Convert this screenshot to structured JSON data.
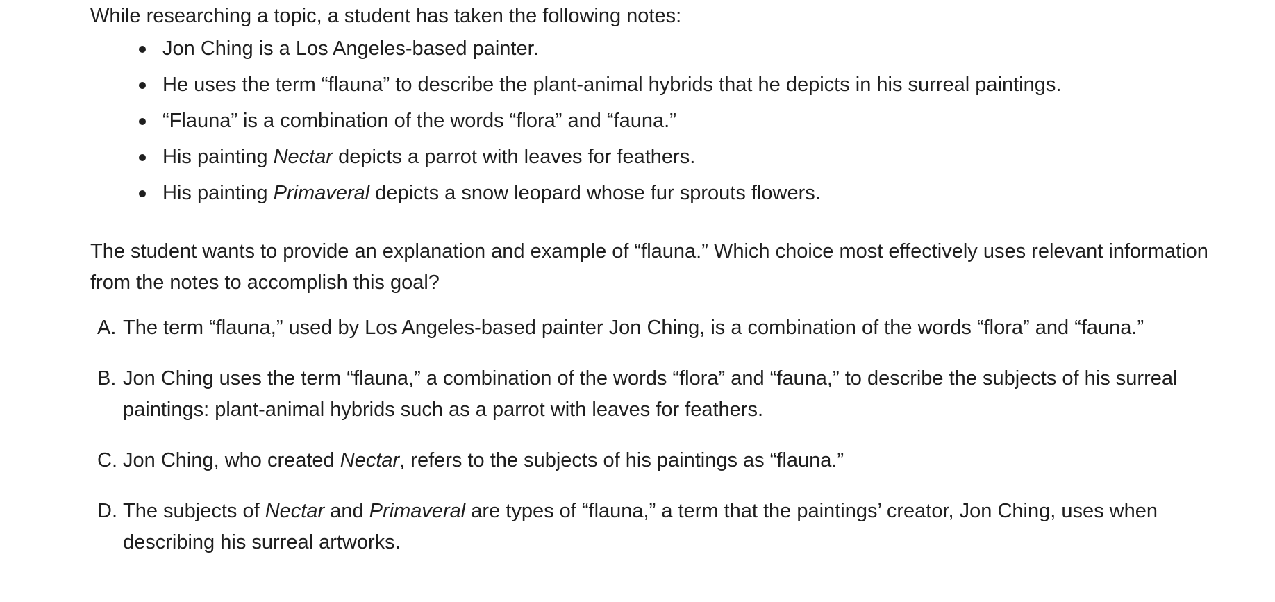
{
  "intro": "While researching a topic, a student has taken the following notes:",
  "notes": [
    {
      "parts": [
        {
          "text": "Jon Ching is a Los Angeles-based painter.",
          "italic": false
        }
      ]
    },
    {
      "parts": [
        {
          "text": "He uses the term “flauna” to describe the plant-animal hybrids that he depicts in his surreal paintings.",
          "italic": false
        }
      ]
    },
    {
      "parts": [
        {
          "text": "“Flauna” is a combination of the words “flora” and “fauna.”",
          "italic": false
        }
      ]
    },
    {
      "parts": [
        {
          "text": "His painting ",
          "italic": false
        },
        {
          "text": "Nectar",
          "italic": true
        },
        {
          "text": " depicts a parrot with leaves for feathers.",
          "italic": false
        }
      ]
    },
    {
      "parts": [
        {
          "text": "His painting ",
          "italic": false
        },
        {
          "text": "Primaveral",
          "italic": true
        },
        {
          "text": " depicts a snow leopard whose fur sprouts flowers.",
          "italic": false
        }
      ]
    }
  ],
  "question": "The student wants to provide an explanation and example of “flauna.” Which choice most effectively uses relevant information from the notes to accomplish this goal?",
  "options": [
    {
      "letter": "A.",
      "parts": [
        {
          "text": "The term “flauna,” used by Los Angeles-based painter Jon Ching, is a combination of the words “flora” and “fauna.”",
          "italic": false
        }
      ]
    },
    {
      "letter": "B.",
      "parts": [
        {
          "text": "Jon Ching uses the term “flauna,” a combination of the words “flora” and “fauna,” to describe the subjects of his surreal paintings: plant-animal hybrids such as a parrot with leaves for feathers.",
          "italic": false
        }
      ]
    },
    {
      "letter": "C.",
      "parts": [
        {
          "text": "Jon Ching, who created ",
          "italic": false
        },
        {
          "text": "Nectar",
          "italic": true
        },
        {
          "text": ", refers to the subjects of his paintings as “flauna.”",
          "italic": false
        }
      ]
    },
    {
      "letter": "D.",
      "parts": [
        {
          "text": "The subjects of ",
          "italic": false
        },
        {
          "text": "Nectar",
          "italic": true
        },
        {
          "text": " and ",
          "italic": false
        },
        {
          "text": "Primaveral",
          "italic": true
        },
        {
          "text": " are types of “flauna,” a term that the paintings’ creator, Jon Ching, uses when describing his surreal artworks.",
          "italic": false
        }
      ]
    }
  ]
}
